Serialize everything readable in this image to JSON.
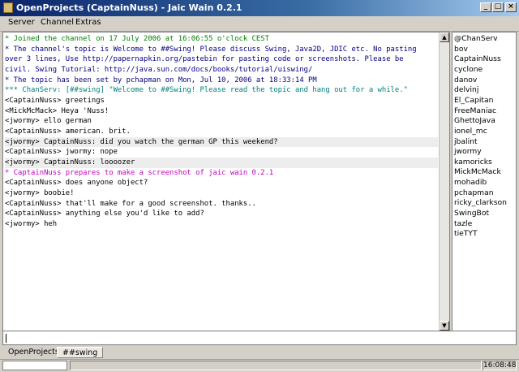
{
  "window": {
    "title": "OpenProjects (CaptainNuss) - Jaic Wain 0.2.1"
  },
  "menu": {
    "items": [
      "Server",
      "Channel",
      "Extras"
    ]
  },
  "colors": {
    "system": "#008000",
    "topic": "#000080",
    "action": "#c000c0",
    "chanserv": "#008080"
  },
  "chat": [
    {
      "kind": "system",
      "text": "* Joined the channel on 17 July 2006 at 16:06:55 o'clock CEST"
    },
    {
      "kind": "topic",
      "text": "* The channel's topic is Welcome to ##Swing! Please discuss Swing, Java2D, JDIC etc. No pasting"
    },
    {
      "kind": "topic",
      "text": "over 3 lines, Use http://papernapkin.org/pastebin for pasting code or screenshots. Please be"
    },
    {
      "kind": "topic",
      "text": "civil. Swing Tutorial: http://java.sun.com/docs/books/tutorial/uiswing/"
    },
    {
      "kind": "topic",
      "text": "* The topic has been set by pchapman on Mon, Jul 10, 2006 at 18:33:14 PM"
    },
    {
      "kind": "chanserv",
      "text": "*** ChanServ: [##swing] \"Welcome to ##Swing! Please read the topic and hang out for a while.\""
    },
    {
      "kind": "normal",
      "text": "<CaptainNuss> greetings"
    },
    {
      "kind": "normal",
      "text": "<MickMcMack> Heya 'Nuss!"
    },
    {
      "kind": "normal",
      "text": "<jwormy> ello german"
    },
    {
      "kind": "normal",
      "text": "<CaptainNuss> american. brit."
    },
    {
      "kind": "highlight",
      "text": "<jwormy> CaptainNuss: did you watch the german GP this weekend?"
    },
    {
      "kind": "normal",
      "text": "<CaptainNuss> jwormy: nope"
    },
    {
      "kind": "highlight",
      "text": "<jwormy> CaptainNuss: loooozer"
    },
    {
      "kind": "action",
      "text": "* CaptainNuss prepares to make a screenshot of jaic wain 0.2.1"
    },
    {
      "kind": "normal",
      "text": "<CaptainNuss> does anyone object?"
    },
    {
      "kind": "normal",
      "text": "<jwormy> boobie!"
    },
    {
      "kind": "normal",
      "text": "<CaptainNuss> that'll make for a good screenshot. thanks.."
    },
    {
      "kind": "normal",
      "text": "<CaptainNuss> anything else you'd like to add?"
    },
    {
      "kind": "normal",
      "text": "<jwormy> heh"
    }
  ],
  "users": [
    "@ChanServ",
    "bov",
    "CaptainNuss",
    "cyclone",
    "danov",
    "delvinj",
    "El_Capitan",
    "FreeManiac",
    "GhettoJava",
    "ionel_mc",
    "jbalint",
    "jwormy",
    "kamoricks",
    "MickMcMack",
    "mohadib",
    "pchapman",
    "ricky_clarkson",
    "SwingBot",
    "tazle",
    "tieTYT"
  ],
  "input": {
    "value": ""
  },
  "tabs": [
    {
      "label": "OpenProjects",
      "active": false
    },
    {
      "label": "##swing",
      "active": true
    }
  ],
  "status": {
    "time": "16:08:48"
  }
}
